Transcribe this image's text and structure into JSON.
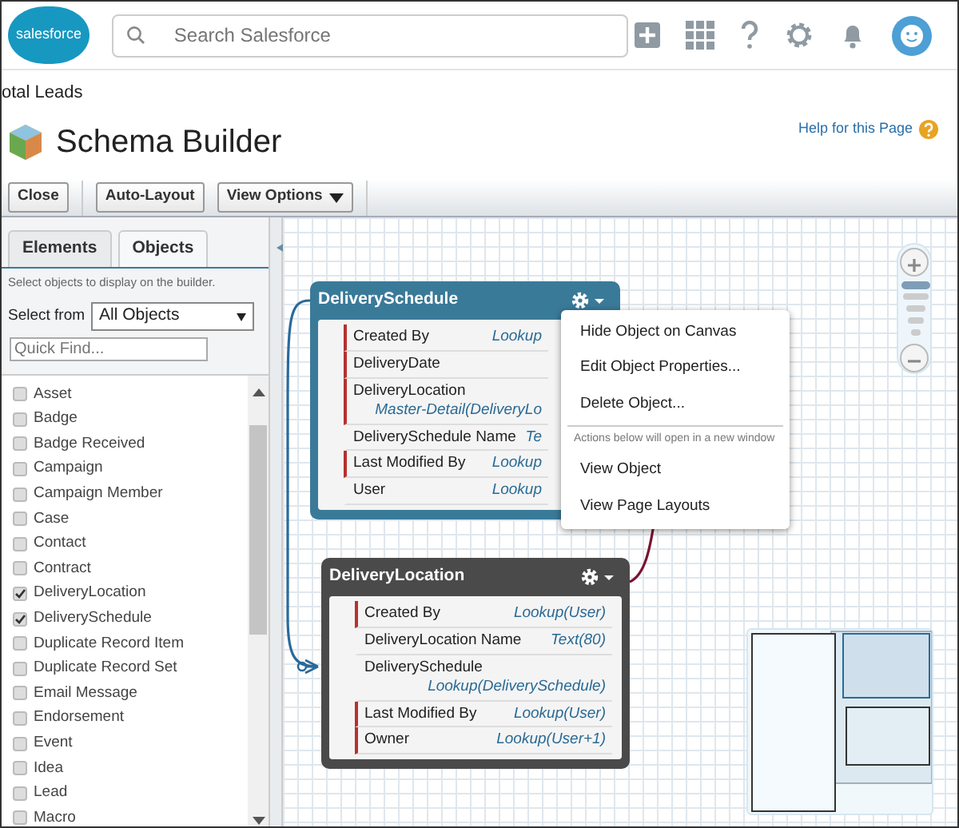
{
  "top_bar": {
    "logo": "salesforce",
    "search": {
      "placeholder": "Search Salesforce"
    }
  },
  "breadcrumb": "otal Leads",
  "page": {
    "title": "Schema Builder",
    "help_link": "Help for this Page"
  },
  "toolbar": {
    "buttons": [
      {
        "label": "Close",
        "dropdown": false
      },
      {
        "label": "Auto-Layout",
        "dropdown": false
      },
      {
        "label": "View Options",
        "dropdown": true
      }
    ]
  },
  "sidebar": {
    "tabs": [
      {
        "label": "Elements",
        "selected": false
      },
      {
        "label": "Objects",
        "selected": true
      }
    ],
    "hint": "Select objects to display on the builder.",
    "select_label": "Select from",
    "select_value": "All Objects",
    "quick_find": {
      "placeholder": "Quick Find..."
    },
    "objects": [
      {
        "label": "Asset",
        "checked": false
      },
      {
        "label": "Badge",
        "checked": false
      },
      {
        "label": "Badge Received",
        "checked": false
      },
      {
        "label": "Campaign",
        "checked": false
      },
      {
        "label": "Campaign Member",
        "checked": false
      },
      {
        "label": "Case",
        "checked": false
      },
      {
        "label": "Contact",
        "checked": false
      },
      {
        "label": "Contract",
        "checked": false
      },
      {
        "label": "DeliveryLocation",
        "checked": true
      },
      {
        "label": "DeliverySchedule",
        "checked": true
      },
      {
        "label": "Duplicate Record Item",
        "checked": false
      },
      {
        "label": "Duplicate Record Set",
        "checked": false
      },
      {
        "label": "Email Message",
        "checked": false
      },
      {
        "label": "Endorsement",
        "checked": false
      },
      {
        "label": "Event",
        "checked": false
      },
      {
        "label": "Idea",
        "checked": false
      },
      {
        "label": "Lead",
        "checked": false
      },
      {
        "label": "Macro",
        "checked": false
      }
    ]
  },
  "canvas": {
    "zoom": {
      "level": 1
    },
    "objects": [
      {
        "name": "DeliverySchedule",
        "selected": true,
        "fields": [
          {
            "name": "Created By",
            "type": "Lookup",
            "required": true
          },
          {
            "name": "DeliveryDate",
            "required": true
          },
          {
            "name": "DeliveryLocation",
            "type": "Master-Detail(DeliveryLo",
            "required": true
          },
          {
            "name": "DeliverySchedule Name",
            "type": "Te",
            "required": false
          },
          {
            "name": "Last Modified By",
            "type": "Lookup",
            "required": true
          },
          {
            "name": "User",
            "type": "Lookup",
            "required": false
          }
        ]
      },
      {
        "name": "DeliveryLocation",
        "selected": false,
        "fields": [
          {
            "name": "Created By",
            "type": "Lookup(User)",
            "required": true
          },
          {
            "name": "DeliveryLocation Name",
            "type": "Text(80)",
            "required": false
          },
          {
            "name": "DeliverySchedule",
            "type": "Lookup(DeliverySchedule)",
            "required": false
          },
          {
            "name": "Last Modified By",
            "type": "Lookup(User)",
            "required": true
          },
          {
            "name": "Owner",
            "type": "Lookup(User+1)",
            "required": true
          }
        ]
      }
    ],
    "menu": {
      "items": [
        {
          "kind": "action",
          "label": "Hide Object on Canvas"
        },
        {
          "kind": "action",
          "label": "Edit Object Properties..."
        },
        {
          "kind": "action",
          "label": "Delete Object..."
        },
        {
          "kind": "note",
          "label": "Actions below will open in a new window"
        },
        {
          "kind": "action",
          "label": "View Object"
        },
        {
          "kind": "action",
          "label": "View Page Layouts"
        }
      ]
    }
  }
}
